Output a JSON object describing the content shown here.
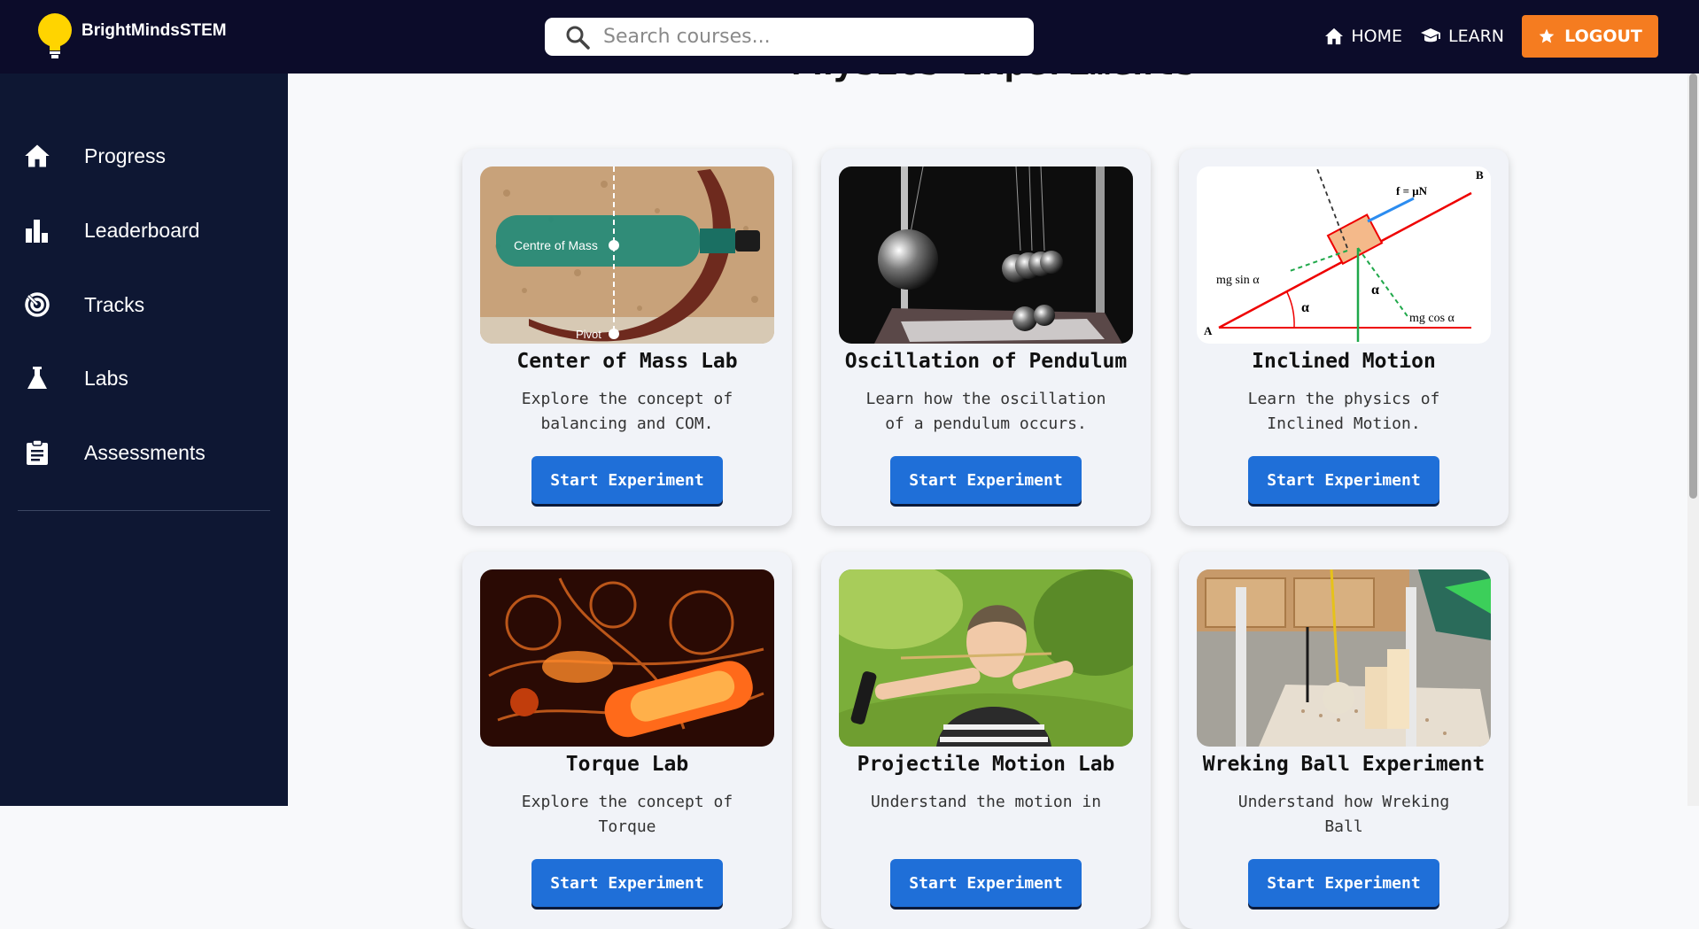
{
  "brand": {
    "name": "BrightMindsSTEM",
    "icon": "lightbulb-icon"
  },
  "search": {
    "placeholder": "Search courses...",
    "value": ""
  },
  "nav": {
    "home_label": "HOME",
    "learn_label": "LEARN",
    "logout_label": "LOGOUT"
  },
  "sidebar": {
    "items": [
      {
        "label": "Progress",
        "icon": "home-icon"
      },
      {
        "label": "Leaderboard",
        "icon": "bar-chart-icon"
      },
      {
        "label": "Tracks",
        "icon": "target-icon"
      },
      {
        "label": "Labs",
        "icon": "flask-icon"
      },
      {
        "label": "Assessments",
        "icon": "clipboard-icon"
      }
    ]
  },
  "main": {
    "title": "Physics Experiments",
    "cards": [
      {
        "title": "Center of Mass Lab",
        "description": "Explore the concept of balancing and COM.",
        "button": "Start Experiment",
        "image_labels": {
          "com": "Centre of Mass",
          "pivot": "Pivot"
        }
      },
      {
        "title": "Oscillation of Pendulum",
        "description": "Learn how the oscillation of a pendulum occurs.",
        "button": "Start Experiment"
      },
      {
        "title": "Inclined Motion",
        "description": "Learn the physics of Inclined Motion.",
        "button": "Start Experiment",
        "image_labels": {
          "friction": "f = μN",
          "sin": "mg sin α",
          "cos": "mg cos α",
          "alpha": "α",
          "a": "A",
          "b": "B"
        }
      },
      {
        "title": "Torque Lab",
        "description": "Explore the concept of Torque",
        "button": "Start Experiment"
      },
      {
        "title": "Projectile Motion Lab",
        "description": "Understand the motion in",
        "button": "Start Experiment"
      },
      {
        "title": "Wreking Ball Experiment",
        "description": "Understand how Wreking Ball",
        "button": "Start Experiment"
      }
    ]
  },
  "colors": {
    "topbar": "#0c0c2a",
    "sidebar": "#0e1733",
    "logout": "#f57c20",
    "button": "#1f6fd8"
  }
}
